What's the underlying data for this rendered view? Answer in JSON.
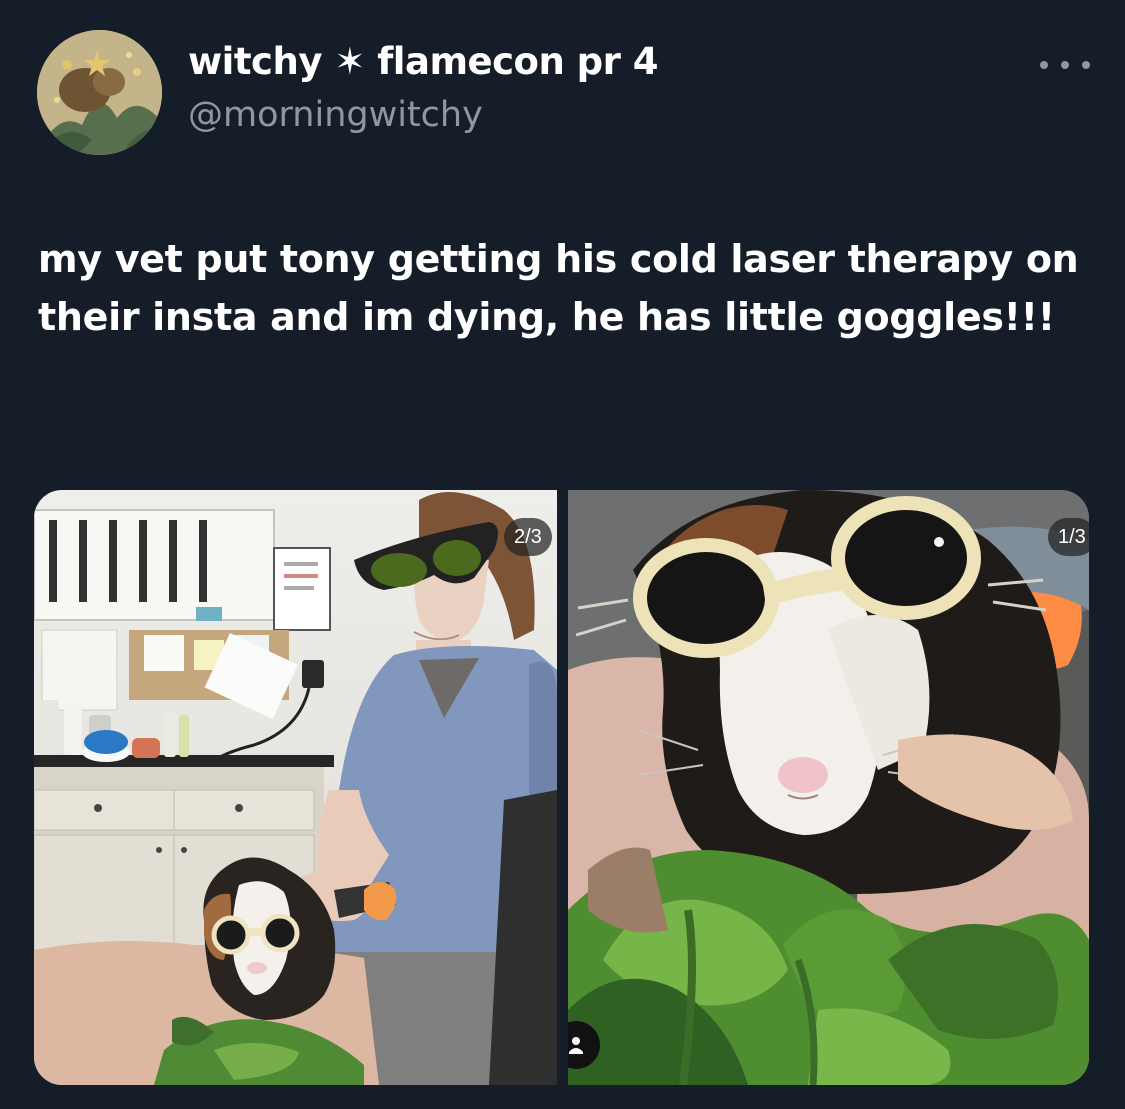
{
  "author": {
    "display_name": "witchy ✶ flamecon pr 4",
    "handle": "@morningwitchy",
    "avatar_icon": "illustrated-avatar"
  },
  "post": {
    "text": "my vet put tony getting his cold laser therapy on their insta and im dying, he has little goggles!!!"
  },
  "media": {
    "left_counter": "2/3",
    "right_counter": "1/3"
  },
  "icons": {
    "more": "more-options-icon",
    "person": "person-tag-icon"
  }
}
